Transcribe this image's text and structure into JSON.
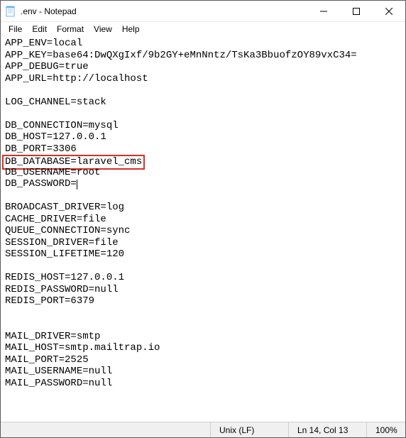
{
  "window": {
    "title": ".env - Notepad"
  },
  "menu": {
    "file": "File",
    "edit": "Edit",
    "format": "Format",
    "view": "View",
    "help": "Help"
  },
  "content": {
    "lines": [
      "APP_ENV=local",
      "APP_KEY=base64:DwQXgIxf/9b2GY+eMnNntz/TsKa3BbuofzOY89vxC34=",
      "APP_DEBUG=true",
      "APP_URL=http://localhost",
      "",
      "LOG_CHANNEL=stack",
      "",
      "DB_CONNECTION=mysql",
      "DB_HOST=127.0.0.1",
      "DB_PORT=3306",
      "DB_DATABASE=laravel_cms",
      "DB_USERNAME=root",
      "DB_PASSWORD=",
      "",
      "BROADCAST_DRIVER=log",
      "CACHE_DRIVER=file",
      "QUEUE_CONNECTION=sync",
      "SESSION_DRIVER=file",
      "SESSION_LIFETIME=120",
      "",
      "REDIS_HOST=127.0.0.1",
      "REDIS_PASSWORD=null",
      "REDIS_PORT=6379",
      "",
      "",
      "MAIL_DRIVER=smtp",
      "MAIL_HOST=smtp.mailtrap.io",
      "MAIL_PORT=2525",
      "MAIL_USERNAME=null",
      "MAIL_PASSWORD=null"
    ],
    "highlighted_line_index": 10,
    "cursor_line_index": 12
  },
  "statusbar": {
    "eol": "Unix (LF)",
    "position": "Ln 14, Col 13",
    "zoom": "100%"
  }
}
